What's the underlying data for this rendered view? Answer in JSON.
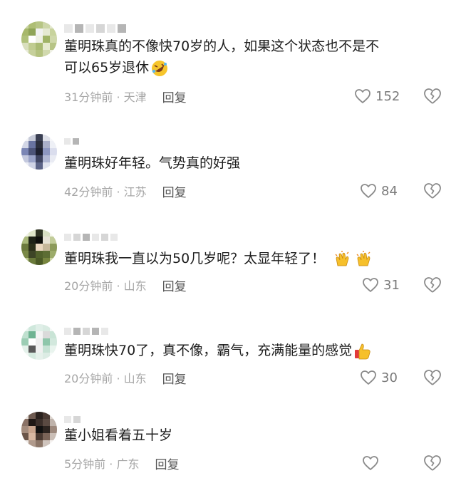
{
  "comments": [
    {
      "text_line1": "董明珠真的不像快70岁的人，如果这个状态也不是不",
      "text_line2": "可以65岁退休",
      "emoji": "rofl-emoji",
      "time": "31分钟前",
      "location": "天津",
      "reply_label": "回复",
      "likes": "152"
    },
    {
      "text_line1": "董明珠好年轻。气势真的好强",
      "time": "42分钟前",
      "location": "江苏",
      "reply_label": "回复",
      "likes": "84"
    },
    {
      "text_line1": "董明珠我一直以为50几岁呢？太显年轻了！",
      "emoji": "clapping-hands-emoji",
      "time": "20分钟前",
      "location": "山东",
      "reply_label": "回复",
      "likes": "31"
    },
    {
      "text_line1": "董明珠快70了，真不像，霸气，充满能量的感觉",
      "emoji": "thumbs-up-emoji",
      "time": "20分钟前",
      "location": "山东",
      "reply_label": "回复",
      "likes": "30"
    },
    {
      "text_line1": "董小姐看着五十岁",
      "time": "5分钟前",
      "location": "广东",
      "reply_label": "回复",
      "likes": ""
    }
  ],
  "separator": " · ",
  "icons": {
    "like": "heart-outline-icon",
    "dislike": "broken-heart-icon"
  },
  "colors": {
    "text": "#1d1d1d",
    "meta": "#a6a6a6",
    "reply": "#555555",
    "icon": "#8a8a8a"
  }
}
